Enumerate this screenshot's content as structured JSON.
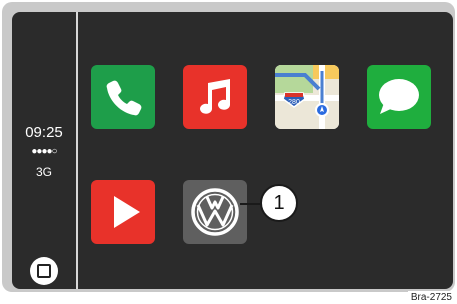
{
  "status": {
    "time": "09:25",
    "signal": "●●●●○",
    "network": "3G"
  },
  "apps": [
    {
      "name": "Phone",
      "icon": "phone-icon",
      "color": "#1e9e4a"
    },
    {
      "name": "Music",
      "icon": "music-note-icon",
      "color": "#e8322a"
    },
    {
      "name": "Maps",
      "icon": "map-icon",
      "color": "#f2f2f2",
      "map_badge": "280"
    },
    {
      "name": "Messages",
      "icon": "speech-bubble-icon",
      "color": "#1fae3e"
    },
    {
      "name": "Play",
      "icon": "play-icon",
      "color": "#e8322a"
    },
    {
      "name": "VW",
      "icon": "vw-logo-icon",
      "color": "#5f5f5f"
    }
  ],
  "callout": {
    "label": "1"
  },
  "figure_code": "Bra-2725"
}
